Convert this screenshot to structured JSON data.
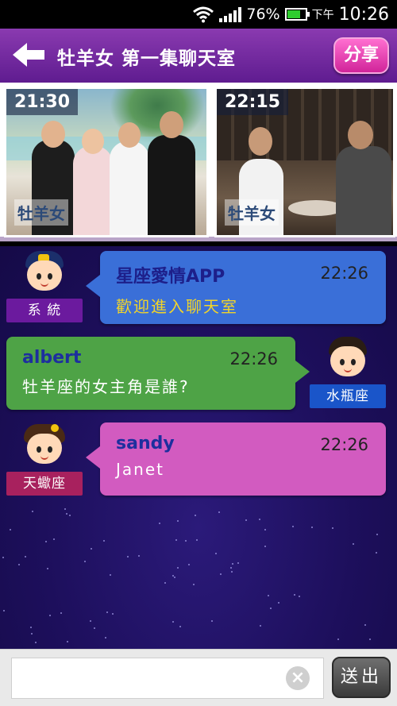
{
  "status_bar": {
    "battery_percent": "76%",
    "ampm": "下午",
    "time": "10:26",
    "battery_level": 0.76,
    "icons": [
      "wifi-icon",
      "signal-icon",
      "battery-icon"
    ]
  },
  "header": {
    "title": "牡羊女 第一集聊天室",
    "share_label": "分享",
    "back_icon": "back-arrow-icon"
  },
  "episodes": [
    {
      "time": "21:30",
      "watermark": "牡羊女"
    },
    {
      "time": "22:15",
      "watermark": "牡羊女"
    }
  ],
  "messages": [
    {
      "user": "系 統",
      "sender": "星座愛情APP",
      "time": "22:26",
      "text": "歡迎進入聊天室",
      "side": "left",
      "bubble_color": "#3a6fd8",
      "name_color": "#1d1f8a",
      "text_color": "#f1d42a",
      "tag_color": "#6b1a9e"
    },
    {
      "user": "水瓶座",
      "sender": "albert",
      "time": "22:26",
      "text": "牡羊座的女主角是誰?",
      "side": "right",
      "bubble_color": "#4ea346",
      "name_color": "#1d2f9e",
      "text_color": "#ffffff",
      "tag_color": "#1a55c9"
    },
    {
      "user": "天蠍座",
      "sender": "sandy",
      "time": "22:26",
      "text": "Janet",
      "side": "left",
      "bubble_color": "#d25bc0",
      "name_color": "#1d2f9e",
      "text_color": "#ffffff",
      "tag_color": "#a8215e"
    }
  ],
  "input": {
    "placeholder": "",
    "send_label": "送出"
  }
}
